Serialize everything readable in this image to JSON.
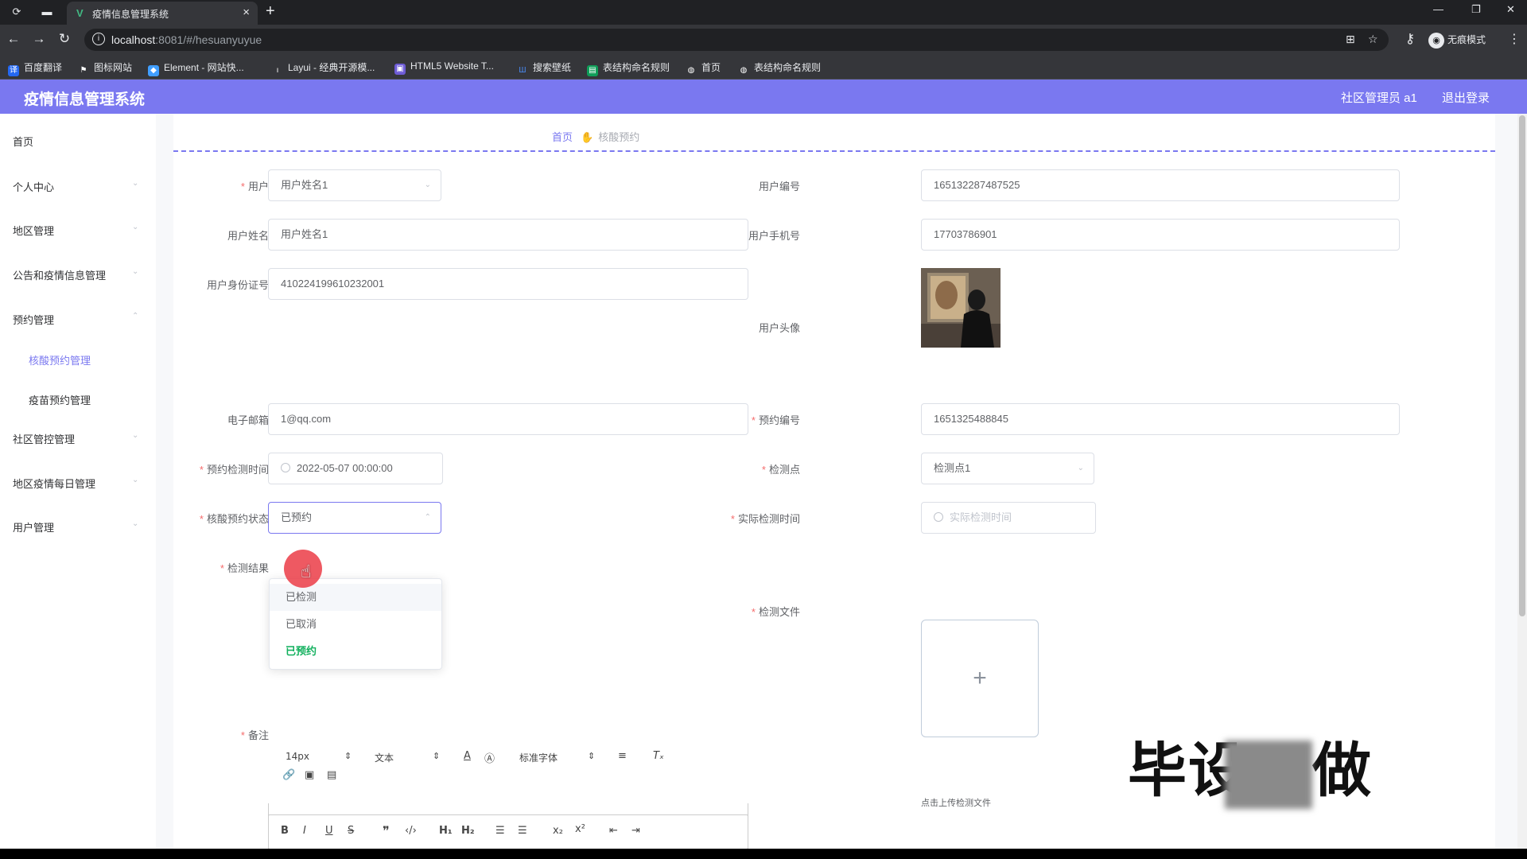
{
  "browser": {
    "tab_title": "疫情信息管理系统",
    "tab_favicon": "V",
    "url_host": "localhost",
    "url_rest": ":8081/#/hesuanyuyue",
    "incognito_label": "无痕模式",
    "bookmarks": [
      {
        "label": "百度翻译",
        "icon": "translate-icon",
        "color": "#2468f2"
      },
      {
        "label": "图标网站",
        "icon": "flag-icon",
        "color": "#35363a"
      },
      {
        "label": "Element - 网站快...",
        "icon": "element-icon",
        "color": "#409eff"
      },
      {
        "label": "Layui - 经典开源模...",
        "icon": "layui-icon",
        "color": "#35363a"
      },
      {
        "label": "HTML5 Website T...",
        "icon": "html5-icon",
        "color": "#6e5cd6"
      },
      {
        "label": "搜索壁纸",
        "icon": "wallpaper-icon",
        "color": "#35363a"
      },
      {
        "label": "表结构命名规则",
        "icon": "sheet-icon",
        "color": "#0f9d58"
      },
      {
        "label": "首页",
        "icon": "globe-icon",
        "color": "#35363a"
      },
      {
        "label": "表结构命名规则",
        "icon": "globe-icon",
        "color": "#35363a"
      }
    ]
  },
  "header": {
    "brand": "疫情信息管理系统",
    "user": "社区管理员 a1",
    "logout": "退出登录",
    "color": "#7a78f0"
  },
  "sidebar": {
    "items": [
      {
        "label": "首页"
      },
      {
        "label": "个人中心"
      },
      {
        "label": "地区管理"
      },
      {
        "label": "公告和疫情信息管理"
      },
      {
        "label": "预约管理"
      },
      {
        "label": "社区管控管理"
      },
      {
        "label": "地区疫情每日管理"
      },
      {
        "label": "用户管理"
      }
    ],
    "sub_items": [
      {
        "label": "核酸预约管理",
        "active": true
      },
      {
        "label": "疫苗预约管理",
        "active": false
      }
    ]
  },
  "breadcrumb": {
    "home": "首页",
    "current": "核酸预约"
  },
  "form": {
    "user_label": "用户",
    "user_value": "用户姓名1",
    "user_no_label": "用户编号",
    "user_no_value": "165132287487525",
    "user_name_label": "用户姓名",
    "user_name_value": "用户姓名1",
    "phone_label": "用户手机号",
    "phone_value": "17703786901",
    "id_card_label": "用户身份证号",
    "id_card_value": "410224199610232001",
    "avatar_label": "用户头像",
    "email_label": "电子邮箱",
    "email_value": "1@qq.com",
    "booking_no_label": "预约编号",
    "booking_no_value": "1651325488845",
    "booking_time_label": "预约检测时间",
    "booking_time_value": "2022-05-07 00:00:00",
    "test_point_label": "检测点",
    "test_point_value": "检测点1",
    "status_label": "核酸预约状态",
    "status_value": "已预约",
    "actual_time_label": "实际检测时间",
    "actual_time_placeholder": "实际检测时间",
    "result_label": "检测结果",
    "file_label": "检测文件",
    "file_tip": "点击上传检测文件",
    "remark_label": "备注"
  },
  "status_dropdown": {
    "options": [
      {
        "label": "已检测",
        "state": "hover"
      },
      {
        "label": "已取消",
        "state": "normal"
      },
      {
        "label": "已预约",
        "state": "selected"
      }
    ]
  },
  "editor": {
    "font_size": "14px",
    "text_style": "文本",
    "font_family": "标准字体"
  },
  "watermark": {
    "text_a": "毕设",
    "text_b": "做"
  }
}
